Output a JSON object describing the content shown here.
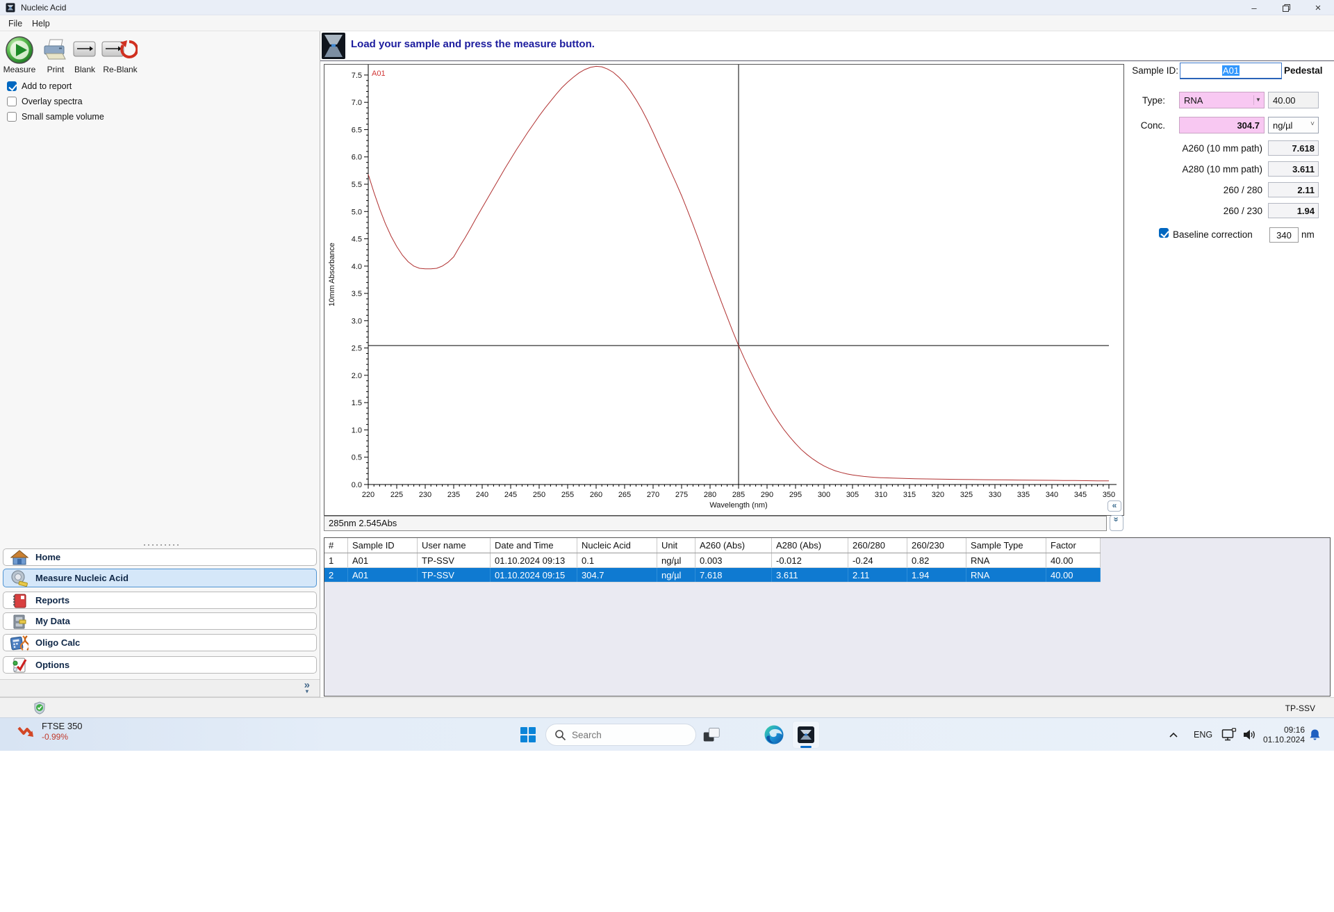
{
  "window": {
    "title": "Nucleic Acid",
    "menu_items": [
      "File",
      "Help"
    ]
  },
  "toolbar": {
    "buttons": [
      {
        "label": "Measure"
      },
      {
        "label": "Print"
      },
      {
        "label": "Blank"
      },
      {
        "label": "Re-Blank"
      }
    ]
  },
  "report_options": [
    {
      "label": "Add to report",
      "checked": true
    },
    {
      "label": "Overlay spectra",
      "checked": false
    },
    {
      "label": "Small sample volume",
      "checked": false
    }
  ],
  "message_bar": {
    "text": "Load your sample and press the measure button."
  },
  "chart_data": {
    "type": "line",
    "title": "",
    "xlabel": "Wavelength (nm)",
    "ylabel": "10mm Absorbance",
    "xlim": [
      220,
      350
    ],
    "ylim": [
      0,
      7.69
    ],
    "x_major_tick": 5,
    "x_minor_tick": 1,
    "y_major_tick": 0.5,
    "y_minor_tick": 0.1,
    "grid": false,
    "crosshair": {
      "x": 285,
      "y": 2.545
    },
    "series": [
      {
        "name": "A01",
        "color": "#b03030",
        "label_color": "#d03333",
        "x": [
          220,
          221,
          222,
          223,
          224,
          225,
          226,
          227,
          228,
          229,
          230,
          231,
          232,
          233,
          234,
          235,
          236,
          237,
          238,
          239,
          240,
          241,
          242,
          243,
          244,
          245,
          246,
          247,
          248,
          249,
          250,
          251,
          252,
          253,
          254,
          255,
          256,
          257,
          258,
          259,
          260,
          261,
          262,
          263,
          264,
          265,
          266,
          267,
          268,
          269,
          270,
          271,
          272,
          273,
          274,
          275,
          276,
          277,
          278,
          279,
          280,
          281,
          282,
          283,
          284,
          285,
          286,
          287,
          288,
          289,
          290,
          291,
          292,
          293,
          294,
          295,
          296,
          297,
          298,
          299,
          300,
          301,
          302,
          303,
          304,
          305,
          306,
          307,
          308,
          309,
          310,
          312,
          314,
          316,
          318,
          320,
          322,
          324,
          326,
          328,
          330,
          332,
          334,
          336,
          338,
          340,
          342,
          344,
          346,
          348,
          350
        ],
        "y": [
          5.68,
          5.35,
          5.05,
          4.78,
          4.55,
          4.36,
          4.2,
          4.08,
          4.0,
          3.96,
          3.95,
          3.95,
          3.96,
          4.0,
          4.07,
          4.17,
          4.35,
          4.52,
          4.7,
          4.89,
          5.07,
          5.25,
          5.43,
          5.61,
          5.79,
          5.96,
          6.13,
          6.29,
          6.45,
          6.6,
          6.75,
          6.89,
          7.02,
          7.15,
          7.27,
          7.37,
          7.46,
          7.54,
          7.6,
          7.64,
          7.66,
          7.65,
          7.61,
          7.55,
          7.46,
          7.35,
          7.21,
          7.05,
          6.87,
          6.67,
          6.45,
          6.22,
          5.99,
          5.76,
          5.53,
          5.29,
          5.03,
          4.76,
          4.48,
          4.19,
          3.9,
          3.62,
          3.34,
          3.07,
          2.8,
          2.545,
          2.31,
          2.09,
          1.88,
          1.68,
          1.49,
          1.31,
          1.15,
          1.0,
          0.87,
          0.75,
          0.64,
          0.55,
          0.47,
          0.4,
          0.34,
          0.29,
          0.25,
          0.22,
          0.195,
          0.175,
          0.16,
          0.148,
          0.139,
          0.131,
          0.125,
          0.117,
          0.111,
          0.106,
          0.102,
          0.098,
          0.095,
          0.092,
          0.09,
          0.088,
          0.086,
          0.084,
          0.082,
          0.08,
          0.078,
          0.076,
          0.074,
          0.072,
          0.07,
          0.068,
          0.067
        ]
      }
    ]
  },
  "spectrum_readout": {
    "value": "285nm 2.545Abs"
  },
  "sample_panel": {
    "sample_id_label": "Sample ID:",
    "sample_id_value": "A01",
    "mode_label": "Pedestal",
    "type_label": "Type:",
    "type_value": "RNA",
    "factor_value": "40.00",
    "conc_label": "Conc.",
    "conc_value": "304.7",
    "unit_value": "ng/µl",
    "rows": [
      {
        "label": "A260 (10 mm path)",
        "value": "7.618"
      },
      {
        "label": "A280 (10 mm path)",
        "value": "3.611"
      },
      {
        "label": "260 / 280",
        "value": "2.11"
      },
      {
        "label": "260 / 230",
        "value": "1.94"
      }
    ],
    "baseline": {
      "label": "Baseline correction",
      "checked": true,
      "value": "340",
      "unit": "nm"
    }
  },
  "results_table": {
    "columns": [
      "#",
      "Sample ID",
      "User name",
      "Date and Time",
      "Nucleic Acid",
      "Unit",
      "A260 (Abs)",
      "A280 (Abs)",
      "260/280",
      "260/230",
      "Sample Type",
      "Factor"
    ],
    "rows": [
      [
        "1",
        "A01",
        "TP-SSV",
        "01.10.2024 09:13",
        "0.1",
        "ng/µl",
        "0.003",
        "-0.012",
        "-0.24",
        "0.82",
        "RNA",
        "40.00"
      ],
      [
        "2",
        "A01",
        "TP-SSV",
        "01.10.2024 09:15",
        "304.7",
        "ng/µl",
        "7.618",
        "3.611",
        "2.11",
        "1.94",
        "RNA",
        "40.00"
      ]
    ],
    "selected_row_index": 1
  },
  "nav": {
    "items": [
      {
        "label": "Home",
        "selected": false
      },
      {
        "label": "Measure Nucleic Acid",
        "selected": true
      },
      {
        "label": "Reports",
        "selected": false
      },
      {
        "label": "My Data",
        "selected": false
      },
      {
        "label": "Oligo Calc",
        "selected": false
      },
      {
        "label": "Options",
        "selected": false
      }
    ]
  },
  "status_bar": {
    "user": "TP-SSV"
  },
  "taskbar": {
    "widget": {
      "title": "FTSE 350",
      "change": "-0.99%"
    },
    "search_placeholder": "Search",
    "tray": {
      "language": "ENG",
      "time": "09:16",
      "date": "01.10.2024"
    }
  }
}
